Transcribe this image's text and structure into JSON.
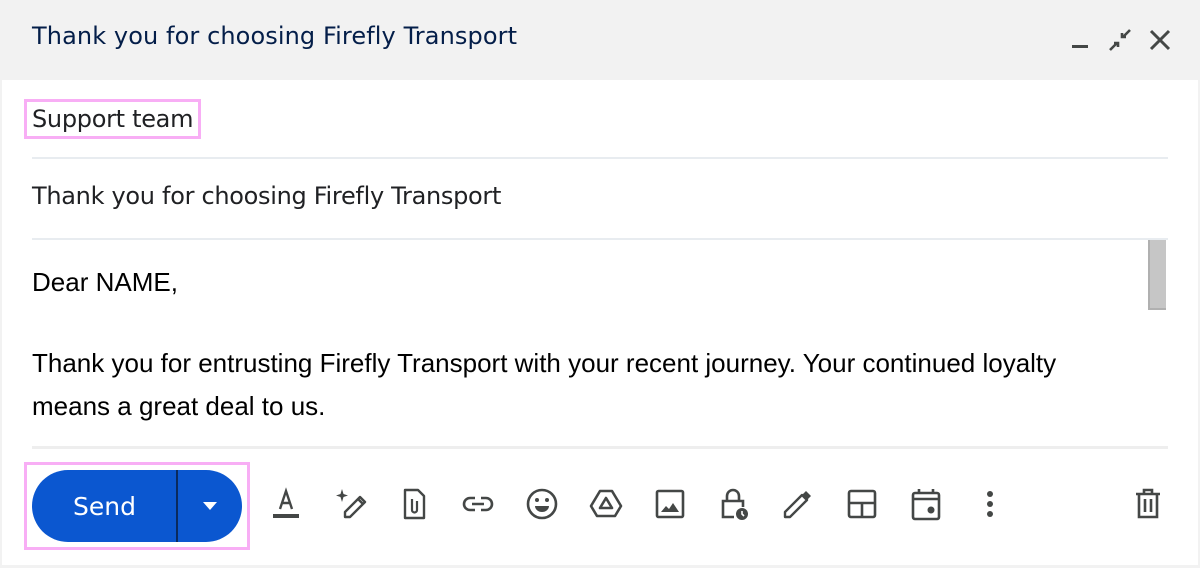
{
  "window": {
    "title": "Thank you for choosing Firefly Transport",
    "controls": {
      "minimize_icon": "minimize-icon",
      "exit_fullscreen_icon": "exit-fullscreen-icon",
      "close_icon": "close-icon"
    }
  },
  "compose": {
    "recipient": "Support team",
    "subject": "Thank you for choosing Firefly Transport",
    "body": {
      "greeting": "Dear NAME,",
      "paragraph": "Thank you for entrusting Firefly Transport with your recent journey. Your continued loyalty means a great deal to us."
    }
  },
  "toolbar": {
    "send_label": "Send",
    "send_options_icon": "caret-down-icon",
    "tools": [
      {
        "name": "formatting-options",
        "icon": "text-format-icon"
      },
      {
        "name": "help-me-write",
        "icon": "sparkle-pen-icon"
      },
      {
        "name": "attach-files",
        "icon": "attachment-icon"
      },
      {
        "name": "insert-link",
        "icon": "link-icon"
      },
      {
        "name": "insert-emoji",
        "icon": "emoji-icon"
      },
      {
        "name": "insert-drive",
        "icon": "drive-icon"
      },
      {
        "name": "insert-photo",
        "icon": "photo-icon"
      },
      {
        "name": "confidential-mode",
        "icon": "lock-clock-icon"
      },
      {
        "name": "insert-signature",
        "icon": "pen-icon"
      },
      {
        "name": "layouts",
        "icon": "layout-icon"
      },
      {
        "name": "schedule-event",
        "icon": "calendar-icon"
      },
      {
        "name": "more-options",
        "icon": "more-vert-icon"
      },
      {
        "name": "discard-draft",
        "icon": "trash-icon"
      }
    ]
  },
  "colors": {
    "accent": "#0b57d0",
    "title": "#041e49",
    "icon": "#444746",
    "highlight": "#f8aef5"
  }
}
